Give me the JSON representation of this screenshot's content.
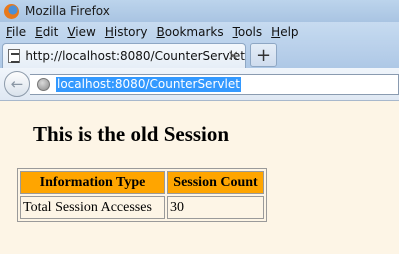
{
  "window": {
    "title": "Mozilla Firefox"
  },
  "menu": [
    {
      "label": "File",
      "accel": "F",
      "rest": "ile"
    },
    {
      "label": "Edit",
      "accel": "E",
      "rest": "dit"
    },
    {
      "label": "View",
      "accel": "V",
      "rest": "iew"
    },
    {
      "label": "History",
      "accel": "H",
      "rest": "istory"
    },
    {
      "label": "Bookmarks",
      "accel": "B",
      "rest": "ookmarks"
    },
    {
      "label": "Tools",
      "accel": "T",
      "rest": "ools"
    },
    {
      "label": "Help",
      "accel": "H",
      "rest": "elp"
    }
  ],
  "tab": {
    "label": "http://localhost:8080/CounterServlet",
    "close": "×",
    "new_tab": "+"
  },
  "nav": {
    "back": "←",
    "url": "localhost:8080/CounterServlet"
  },
  "page": {
    "heading": "This is the old Session",
    "table": {
      "headers": [
        "Information Type",
        "Session Count"
      ],
      "rows": [
        [
          "Total Session Accesses",
          "30"
        ]
      ]
    }
  },
  "colors": {
    "page_background": "#fdf5e6",
    "header_background": "#ffa500",
    "url_selection": "#3399ff"
  }
}
